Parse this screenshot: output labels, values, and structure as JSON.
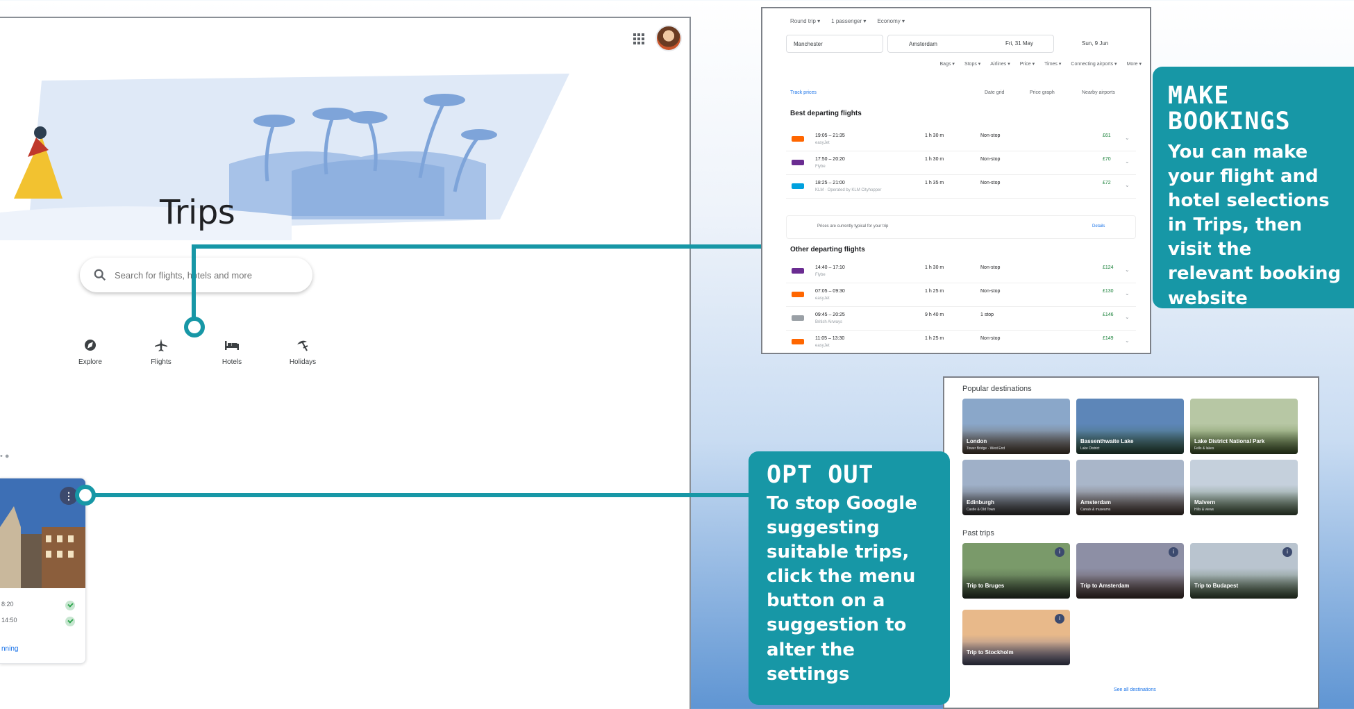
{
  "trips_page": {
    "title": "Trips",
    "search_placeholder": "Search for flights, hotels and more",
    "categories": [
      {
        "label": "Explore",
        "icon": "compass-icon"
      },
      {
        "label": "Flights",
        "icon": "airplane-icon"
      },
      {
        "label": "Hotels",
        "icon": "bed-icon"
      },
      {
        "label": "Holidays",
        "icon": "beach-umbrella-icon"
      }
    ],
    "card": {
      "menu_glyph": "⋮",
      "lines": [
        "8:20",
        "14:50"
      ],
      "link": "nning"
    }
  },
  "flights_panel": {
    "top_options": [
      "Round trip ▾",
      "1 passenger ▾",
      "Economy ▾"
    ],
    "origin": "Manchester",
    "destination": "Amsterdam",
    "depart": "Fri, 31 May",
    "return": "Sun, 9 Jun",
    "filters": [
      "Bags ▾",
      "Stops ▾",
      "Airlines ▾",
      "Price ▾",
      "Times ▾",
      "Connecting airports ▾",
      "More ▾"
    ],
    "tools_left": "Track prices",
    "tools_right": [
      "Date grid",
      "Price graph",
      "Nearby airports"
    ],
    "best_heading": "Best departing flights",
    "best": [
      {
        "time": "19:05 – 21:35",
        "sub": "easyJet",
        "dur": "1 h 30 m",
        "stops": "Non-stop",
        "price": "£61"
      },
      {
        "time": "17:50 – 20:20",
        "sub": "Flybe",
        "dur": "1 h 30 m",
        "stops": "Non-stop",
        "price": "£70"
      },
      {
        "time": "18:25 – 21:00",
        "sub": "KLM · Operated by KLM Cityhopper",
        "dur": "1 h 35 m",
        "stops": "Non-stop",
        "price": "£72"
      }
    ],
    "note": "Prices are currently typical for your trip",
    "note_link": "Details",
    "other_heading": "Other departing flights",
    "other": [
      {
        "time": "14:40 – 17:10",
        "sub": "Flybe",
        "dur": "1 h 30 m",
        "stops": "Non-stop",
        "price": "£124"
      },
      {
        "time": "07:05 – 09:30",
        "sub": "easyJet",
        "dur": "1 h 25 m",
        "stops": "Non-stop",
        "price": "£130"
      },
      {
        "time": "09:45 – 20:25",
        "sub": "British Airways",
        "dur": "9 h 40 m",
        "stops": "1 stop",
        "price": "£146"
      },
      {
        "time": "11:05 – 13:30",
        "sub": "easyJet",
        "dur": "1 h 25 m",
        "stops": "Non-stop",
        "price": "£149"
      }
    ]
  },
  "destinations_panel": {
    "popular_heading": "Popular destinations",
    "popular": [
      {
        "name": "London",
        "desc": "Tower Bridge · West End",
        "colors": [
          "#8aa7c9",
          "#6d5a48"
        ]
      },
      {
        "name": "Bassenthwaite Lake",
        "desc": "Lake District",
        "colors": [
          "#5d86b8",
          "#3f6a54"
        ]
      },
      {
        "name": "Lake District National Park",
        "desc": "Fells & lakes",
        "colors": [
          "#b7c7a4",
          "#5c7a3e"
        ]
      },
      {
        "name": "Edinburgh",
        "desc": "Castle & Old Town",
        "colors": [
          "#9fb0c8",
          "#4d4a4a"
        ]
      },
      {
        "name": "Amsterdam",
        "desc": "Canals & museums",
        "colors": [
          "#a9b6c9",
          "#5e4c44"
        ]
      },
      {
        "name": "Malvern",
        "desc": "Hills & views",
        "colors": [
          "#c5d0dc",
          "#607a58"
        ]
      }
    ],
    "past_heading": "Past trips",
    "past": [
      {
        "name": "Trip to Bruges",
        "desc": "",
        "colors": [
          "#7a9a6a",
          "#3e4e3a"
        ]
      },
      {
        "name": "Trip to Amsterdam",
        "desc": "",
        "colors": [
          "#8d8fa5",
          "#5a4540"
        ]
      },
      {
        "name": "Trip to Budapest",
        "desc": "",
        "colors": [
          "#b9c4cf",
          "#526a4a"
        ]
      },
      {
        "name": "Trip to Stockholm",
        "desc": "",
        "colors": [
          "#e8b98a",
          "#6a6e96"
        ]
      }
    ],
    "more_link": "See all destinations"
  },
  "callouts": {
    "bookings": {
      "title": "MAKE BOOKINGS",
      "body": "You can make your flight and hotel selections in Trips, then visit the relevant booking website"
    },
    "optout": {
      "title": "OPT OUT",
      "body": "To stop Google suggesting suitable trips, click the menu button on a suggestion to alter the settings"
    }
  },
  "colors": {
    "accent": "#1797a6",
    "google_blue": "#1a73e8",
    "price_green": "#188038"
  }
}
